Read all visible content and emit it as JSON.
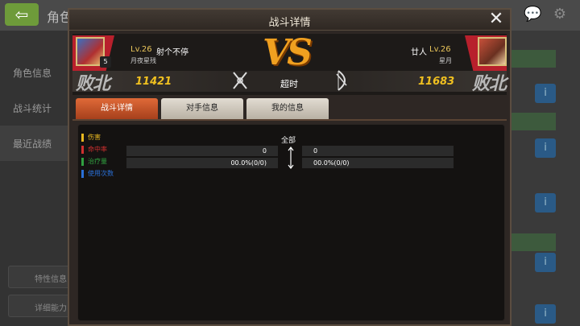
{
  "background": {
    "title": "角色",
    "sidebar": [
      {
        "label": "角色信息"
      },
      {
        "label": "战斗统计"
      },
      {
        "label": "最近战绩"
      }
    ],
    "lower_buttons": [
      {
        "label": "特性信息"
      },
      {
        "label": "详细能力"
      }
    ]
  },
  "modal": {
    "title": "战斗详情",
    "close_icon": "close-x-icon"
  },
  "battle": {
    "vs_text": "VS",
    "outcome": "超时",
    "left": {
      "level": "Lv.26",
      "name": "射个不停",
      "guild": "月夜星残",
      "result": "败北",
      "power": "11421",
      "star": "5"
    },
    "right": {
      "name": "廿人",
      "level": "Lv.26",
      "guild": "星月",
      "result": "败北",
      "power": "11683"
    }
  },
  "tabs": [
    {
      "label": "战斗详情",
      "active": true
    },
    {
      "label": "对手信息",
      "active": false
    },
    {
      "label": "我的信息",
      "active": false
    }
  ],
  "stats": {
    "filter_label": "全部",
    "legend": [
      {
        "label": "伤害",
        "color": "#e8b820"
      },
      {
        "label": "命中率",
        "color": "#d03030"
      },
      {
        "label": "治疗量",
        "color": "#30a040"
      },
      {
        "label": "使用次数",
        "color": "#2a70d8"
      }
    ],
    "rows": [
      {
        "left": "0",
        "right": "0"
      },
      {
        "left": "00.0%(0/0)",
        "right": "00.0%(0/0)"
      }
    ]
  }
}
